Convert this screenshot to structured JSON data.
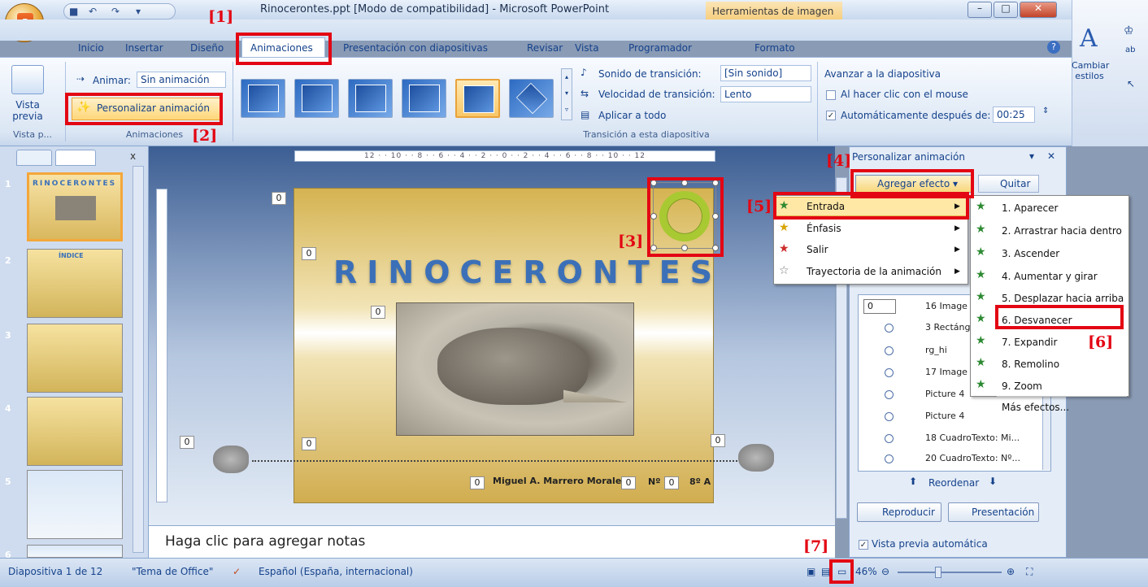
{
  "window": {
    "title": "Rinocerontes.ppt [Modo de compatibilidad] - Microsoft PowerPoint",
    "context_tools": "Herramientas de imagen",
    "office_glyph": "P"
  },
  "tabs": [
    "Inicio",
    "Insertar",
    "Diseño",
    "Animaciones",
    "Presentación con diapositivas",
    "Revisar",
    "Vista",
    "Programador",
    "Formato"
  ],
  "ribbon": {
    "preview_label": "Vista previa",
    "preview_group": "Vista p...",
    "animate_label": "Animar:",
    "animate_value": "Sin animación",
    "custom_anim_button": "Personalizar animación",
    "animations_group": "Animaciones",
    "sound_label": "Sonido de transición:",
    "sound_value": "[Sin sonido]",
    "speed_label": "Velocidad de transición:",
    "speed_value": "Lento",
    "apply_all": "Aplicar a todo",
    "transition_group": "Transición a esta diapositiva",
    "advance_title": "Avanzar a la diapositiva",
    "on_click": "Al hacer clic con el mouse",
    "auto_after": "Automáticamente después de:",
    "auto_time": "00:25",
    "styles_label": "Cambiar estilos"
  },
  "thumbnails": [
    {
      "num": "1",
      "text": "RINOCERONTES"
    },
    {
      "num": "2",
      "text": "ÍNDICE"
    },
    {
      "num": "3",
      "text": ""
    },
    {
      "num": "4",
      "text": ""
    },
    {
      "num": "5",
      "text": ""
    },
    {
      "num": "6",
      "text": ""
    }
  ],
  "ruler": "12 · · 10 · · 8 · · 6 · · 4 · · 2 · · 0 · · 2 · · 4 · · 6 · · 8 · · 10 · · 12",
  "slide": {
    "title": "RINOCERONTES",
    "zero": "0",
    "author": "Miguel A. Marrero Morales",
    "num_label": "Nº",
    "grade": "8º A"
  },
  "notes_placeholder": "Haga clic para agregar notas",
  "task_pane": {
    "title": "Personalizar animación",
    "add_effect": "Agregar efecto",
    "remove": "Quitar",
    "items": [
      "16 Image",
      "3 Rectáng",
      "rg_hi",
      "17 Image",
      "Picture 4",
      "Picture 4",
      "18 CuadroTexto: Mi...",
      "20 CuadroTexto: Nº..."
    ],
    "list_number": "0",
    "reorder": "Reordenar",
    "play": "Reproducir",
    "slideshow": "Presentación",
    "autopreview": "Vista previa automática"
  },
  "menu_effects": [
    "Entrada",
    "Énfasis",
    "Salir",
    "Trayectoria de la animación"
  ],
  "menu_entry": [
    "1. Aparecer",
    "2. Arrastrar hacia dentro",
    "3. Ascender",
    "4. Aumentar y girar",
    "5. Desplazar hacia arriba",
    "6. Desvanecer",
    "7. Expandir",
    "8. Remolino",
    "9. Zoom",
    "Más efectos..."
  ],
  "status": {
    "slide_info": "Diapositiva 1 de 12",
    "theme": "\"Tema de Office\"",
    "language": "Español (España, internacional)",
    "zoom": "46%"
  },
  "annotations": [
    "[1]",
    "[2]",
    "[3]",
    "[4]",
    "[5]",
    "[6]",
    "[7]"
  ],
  "colors": {
    "accent": "#e30613",
    "ribbon": "#dbe6f4",
    "selection": "#f4a73b"
  }
}
